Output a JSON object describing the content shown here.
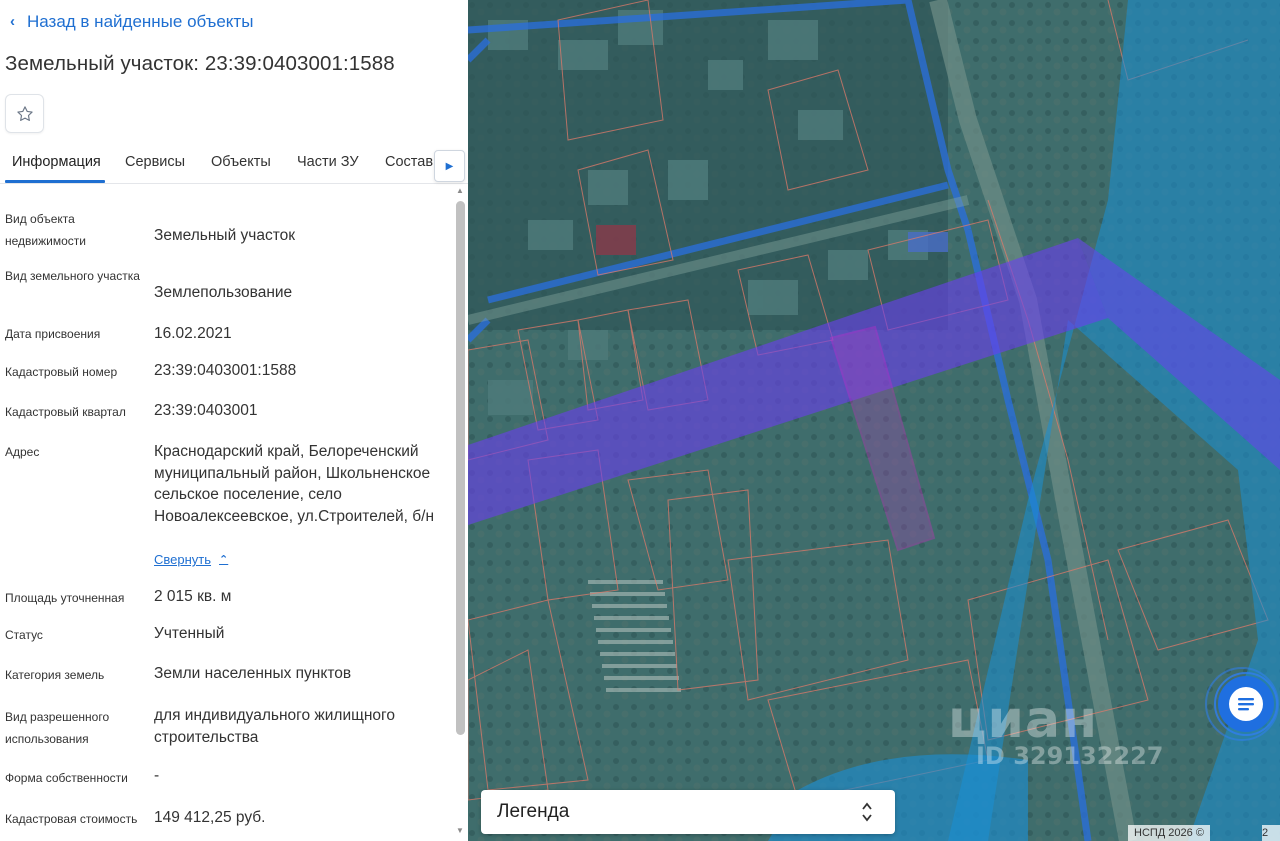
{
  "back_link": {
    "label": "Назад в найденные объекты"
  },
  "title": "Земельный участок: 23:39:0403001:1588",
  "favorite": {
    "icon": "star-outline-icon"
  },
  "tabs": [
    {
      "label": "Информация",
      "active": true
    },
    {
      "label": "Сервисы",
      "active": false
    },
    {
      "label": "Объекты",
      "active": false
    },
    {
      "label": "Части ЗУ",
      "active": false
    },
    {
      "label": "Состав",
      "active": false
    }
  ],
  "details": [
    {
      "label": "Вид объекта недвижимости",
      "value": "Земельный участок"
    },
    {
      "label": "Вид земельного участка",
      "value": "Землепользование"
    },
    {
      "label": "Дата присвоения",
      "value": "16.02.2021"
    },
    {
      "label": "Кадастровый номер",
      "value": "23:39:0403001:1588"
    },
    {
      "label": "Кадастровый квартал",
      "value": "23:39:0403001"
    },
    {
      "label": "Адрес",
      "value": "Краснодарский край, Белореченский муниципальный район, Школьненское сельское поселение, село Новоалексеевское, ул.Строителей, б/н"
    },
    {
      "label": "Площадь уточненная",
      "value": "2 015 кв. м"
    },
    {
      "label": "Статус",
      "value": "Учтенный"
    },
    {
      "label": "Категория земель",
      "value": "Земли населенных пунктов"
    },
    {
      "label": "Вид разрешенного использования",
      "value": "для индивидуального жилищного строительства"
    },
    {
      "label": "Форма собственности",
      "value": "-"
    },
    {
      "label": "Кадастровая стоимость",
      "value": "149 412,25 руб."
    }
  ],
  "address_collapse": {
    "label": "Свернуть"
  },
  "map": {
    "watermark_logo": "циан",
    "watermark_id": "ID 329132227",
    "legend_label": "Легенда",
    "attribution": "НСПД 2026 ©",
    "scale_label": "2",
    "colors": {
      "zone_purple": "#6a3ef0",
      "zone_blue": "#1a8fd6",
      "parcel_highlight": "#e020d0",
      "parcel_lines": "#e07a6a",
      "road_blue": "#2a6fe0"
    }
  }
}
